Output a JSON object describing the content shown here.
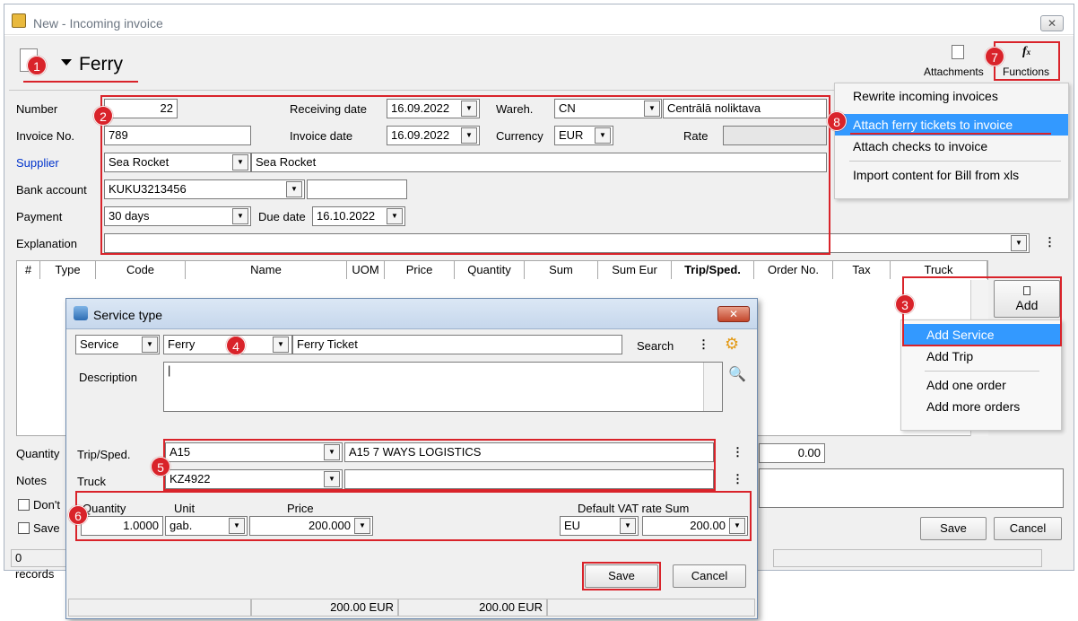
{
  "window": {
    "title": "New - Incoming invoice",
    "close": "✕"
  },
  "doc": {
    "title": "Ferry"
  },
  "toolbar": {
    "attachments": "Attachments",
    "functions": "Functions"
  },
  "badges": [
    "1",
    "2",
    "3",
    "4",
    "5",
    "6",
    "7",
    "8"
  ],
  "form": {
    "number_label": "Number",
    "number": "22",
    "invoice_no_label": "Invoice No.",
    "invoice_no": "789",
    "supplier_label": "Supplier",
    "supplier_code": "Sea Rocket",
    "supplier_name": "Sea Rocket",
    "bank_label": "Bank account",
    "bank": "KUKU3213456",
    "payment_label": "Payment",
    "payment": "30 days",
    "due_label": "Due date",
    "due": "16.10.2022",
    "explanation_label": "Explanation",
    "receiving_label": "Receiving date",
    "receiving": "16.09.2022",
    "invoice_date_label": "Invoice date",
    "invoice_date": "16.09.2022",
    "wareh_label": "Wareh.",
    "wareh_code": "CN",
    "wareh_name": "Centrālā noliktava",
    "currency_label": "Currency",
    "currency": "EUR",
    "rate_label": "Rate"
  },
  "functions_menu": [
    "Rewrite incoming invoices",
    "Attach ferry tickets to invoice",
    "Attach checks to invoice",
    "Import content for Bill from xls"
  ],
  "table": {
    "columns": [
      "#",
      "Type",
      "Code",
      "Name",
      "UOM",
      "Price",
      "Quantity",
      "Sum",
      "Sum Eur",
      "Trip/Sped.",
      "Order No.",
      "Tax",
      "Truck"
    ]
  },
  "add_button": "Add",
  "add_menu": [
    "Add Service",
    "Add Trip",
    "Add one order",
    "Add more orders"
  ],
  "bottom": {
    "quantity_label": "Quantity",
    "notes_label": "Notes",
    "dont_label": "Don't",
    "save_label": "Save",
    "total": "0.00",
    "records": "0 records",
    "save_btn": "Save",
    "cancel_btn": "Cancel"
  },
  "dialog": {
    "title": "Service type",
    "type": "Service",
    "service_code": "Ferry",
    "service_name": "Ferry Ticket",
    "search": "Search",
    "description_label": "Description",
    "description": "|",
    "trip_label": "Trip/Sped.",
    "trip_code": "A15",
    "trip_name": "A15 7 WAYS LOGISTICS",
    "truck_label": "Truck",
    "truck_code": "KZ4922",
    "qty_label": "Quantity",
    "qty": "1.0000",
    "unit_label": "Unit",
    "unit": "gab.",
    "price_label": "Price",
    "price": "200.000",
    "vat_label": "Default VAT rate Sum",
    "vat": "EU",
    "sum": "200.00",
    "save": "Save",
    "cancel": "Cancel",
    "status1": "200.00 EUR",
    "status2": "200.00 EUR"
  }
}
